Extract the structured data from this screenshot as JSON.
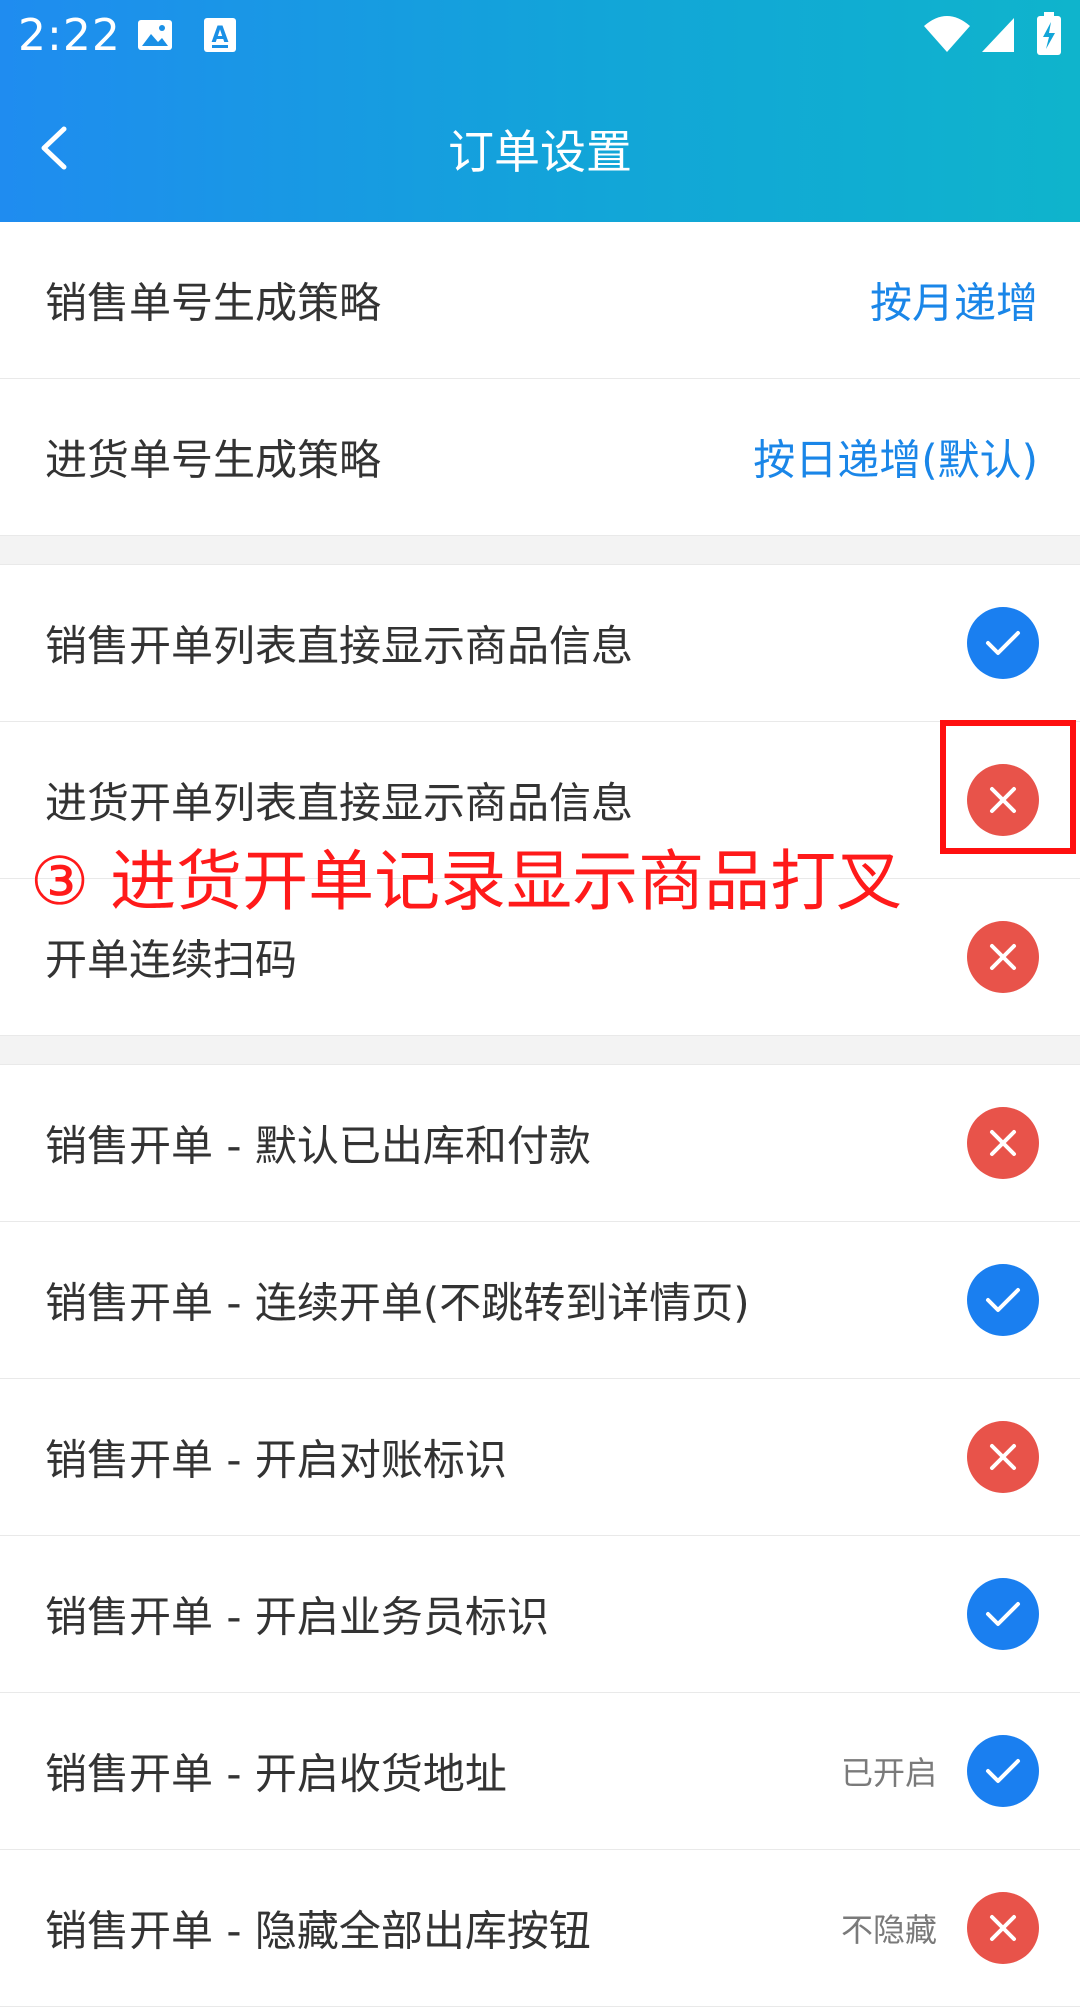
{
  "status_bar": {
    "time": "2:22"
  },
  "header": {
    "title": "订单设置"
  },
  "colors": {
    "header_gradient_start": "#1f8cf0",
    "header_gradient_end": "#0fb4cc",
    "accent_blue": "#1a86e8",
    "toggle_on": "#1a7ff0",
    "toggle_off": "#e8534a",
    "annotation_red": "#ff1a1a"
  },
  "strategy_rows": [
    {
      "label": "销售单号生成策略",
      "value": "按月递增"
    },
    {
      "label": "进货单号生成策略",
      "value": "按日递增(默认)"
    }
  ],
  "display_rows": [
    {
      "label": "销售开单列表直接显示商品信息",
      "checked": true
    },
    {
      "label": "进货开单列表直接显示商品信息",
      "checked": false
    },
    {
      "label": "开单连续扫码",
      "checked": false
    }
  ],
  "sales_rows": [
    {
      "label": "销售开单 - 默认已出库和付款",
      "checked": false
    },
    {
      "label": "销售开单 - 连续开单(不跳转到详情页)",
      "checked": true
    },
    {
      "label": "销售开单 - 开启对账标识",
      "checked": false
    },
    {
      "label": "销售开单 - 开启业务员标识",
      "checked": true
    },
    {
      "label": "销售开单 - 开启收货地址",
      "status": "已开启",
      "checked": true
    },
    {
      "label": "销售开单 - 隐藏全部出库按钮",
      "status": "不隐藏",
      "checked": false
    }
  ],
  "annotation": {
    "text": "③ 进货开单记录显示商品打叉"
  },
  "icons": {
    "back": "chevron-left-icon",
    "check": "check-icon",
    "cross": "close-icon",
    "gallery": "image-icon",
    "font": "font-icon",
    "wifi": "wifi-icon",
    "signal": "signal-icon",
    "battery": "battery-charging-icon"
  }
}
